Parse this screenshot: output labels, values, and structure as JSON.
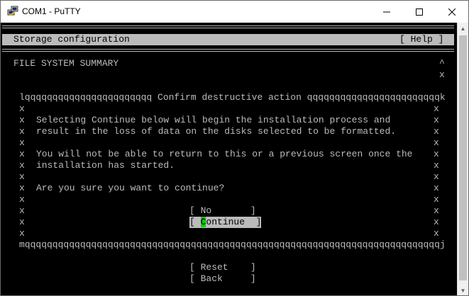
{
  "window": {
    "title": "COM1 - PuTTY",
    "icon": "putty-icon",
    "controls": {
      "minimize": "minimize-icon",
      "maximize": "maximize-icon",
      "close": "close-icon"
    }
  },
  "terminal": {
    "header": {
      "title": "Storage configuration",
      "help": "[ Help ]"
    },
    "section_title": "FILE SYSTEM SUMMARY",
    "scroll_up_marker": "^",
    "scroll_x_marker": "x",
    "dialog": {
      "top_border": "lqqqqqqqqqqqqqqqqqqqqqqq Confirm destructive action qqqqqqqqqqqqqqqqqqqqqqqqk",
      "bottom_border": "mqqqqqqqqqqqqqqqqqqqqqqqqqqqqqqqqqqqqqqqqqqqqqqqqqqqqqqqqqqqqqqqqqqqqqqqqqqqj",
      "side_char": "x",
      "text_lines": [
        "",
        "Selecting Continue below will begin the installation process and",
        "result in the loss of data on the disks selected to be formatted.",
        "",
        "You will not be able to return to this or a previous screen once the",
        "installation has started.",
        "",
        "Are you sure you want to continue?",
        "",
        "",
        "",
        ""
      ],
      "buttons": {
        "no": "[ No       ]",
        "continue_open": "[ ",
        "continue_cursor": "C",
        "continue_rest": "ontinue  ]"
      }
    },
    "footer_buttons": {
      "reset": "[ Reset    ]",
      "back": "[ Back     ]"
    }
  },
  "colors": {
    "terminal_bg": "#000000",
    "terminal_fg": "#bbbbbb",
    "cursor": "#00d000",
    "selected_bg": "#bbbbbb"
  }
}
